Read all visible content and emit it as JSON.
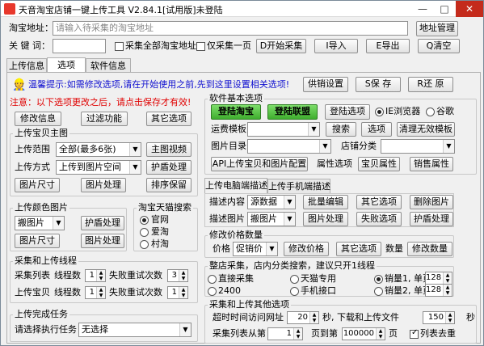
{
  "window": {
    "title": "天音淘宝店铺一键上传工具 V2.84.1[试用版]未登陆"
  },
  "top": {
    "url_label": "淘宝地址：",
    "url_placeholder": "请输入待采集的淘宝地址",
    "url_manage": "地址管理",
    "keyword_label": "关 键 词：",
    "keyword_value": "",
    "chk_all_shop": "采集全部淘宝地址",
    "chk_one_page": "仅采集一页",
    "btn_start": "D开始采集",
    "btn_import": "I导入",
    "btn_export": "E导出",
    "btn_clear": "Q清空"
  },
  "tabs": [
    {
      "label": "上传信息",
      "active": false
    },
    {
      "label": "选项",
      "active": true
    },
    {
      "label": "软件信息",
      "active": false
    }
  ],
  "tip": {
    "text": "温馨提示:如需修改选项,请在开始使用之前,先到这里设置相关选项!",
    "btn_supply": "供销设置",
    "btn_save": "S保 存",
    "btn_restore": "R还 原"
  },
  "left": {
    "warning": "注意：以下选项更改之后，请点击保存才有效!",
    "btn_modify": "修改信息",
    "btn_filter": "过滤功能",
    "btn_other": "其它选项",
    "main_pic": {
      "title": "上传宝贝主图",
      "range_label": "上传范围",
      "range_value": "全部(最多6张)",
      "btn_video": "主图视频",
      "method_label": "上传方式",
      "method_value": "上传到图片空间",
      "btn_shield": "护盾处理",
      "btn_size": "图片尺寸",
      "btn_process": "图片处理",
      "btn_sort": "排序保留"
    },
    "color_pic": {
      "title": "上传颜色图片",
      "value": "搬图片",
      "btn_shield": "护盾处理",
      "btn_size": "图片尺寸",
      "btn_process": "图片处理"
    },
    "tmall": {
      "title": "淘宝天猫搜索",
      "opt1": "官网",
      "opt2": "爱淘",
      "opt3": "村淘"
    },
    "threads": {
      "title": "采集和上传线程",
      "list_label": "采集列表",
      "item_label": "上传宝贝",
      "threads_label": "线程数",
      "retry_label": "失败重试次数",
      "list_threads": "1",
      "list_retry": "3",
      "item_threads": "1",
      "item_retry": "1"
    },
    "finish": {
      "title": "上传完成任务",
      "label": "请选择执行任务",
      "value": "无选择"
    }
  },
  "right": {
    "basic": {
      "title": "软件基本选项",
      "btn_login_tb": "登陆淘宝",
      "btn_login_union": "登陆联盟",
      "btn_login_opt": "登陆选项",
      "browser_ie": "IE浏览器",
      "browser_chrome": "谷歌",
      "shipping_label": "运费模板",
      "btn_search": "搜索",
      "btn_options": "选项",
      "btn_clean_tpl": "清理无效模板",
      "dir_label": "图片目录",
      "shop_cat_label": "店铺分类",
      "btn_api": "API上传宝贝和图片配置",
      "attr_label": "属性选项",
      "btn_attr": "宝贝属性",
      "btn_sales_attr": "销售属性"
    },
    "desc_tabs": [
      "上传电脑端描述",
      "上传手机端描述"
    ],
    "desc": {
      "content_label": "描述内容",
      "content_value": "源数据",
      "btn_batch": "批量编辑",
      "btn_other": "其它选项",
      "btn_delete_pic": "删除图片",
      "pic_label": "描述图片",
      "pic_value": "搬图片",
      "btn_process": "图片处理",
      "btn_fail": "失败选项",
      "btn_shield": "护盾处理"
    },
    "price": {
      "title": "修改价格数量",
      "label": "价格",
      "value": "促销价",
      "btn_modify": "修改价格",
      "btn_other": "其它选项",
      "qty_label": "数量",
      "btn_qty": "修改数量"
    },
    "shop": {
      "title": "整店采集，店内分类搜索，建议只开1线程",
      "opt1": "直接采集",
      "opt2": "天猫专用",
      "opt3": "2400",
      "opt4": "手机接口",
      "opt5": "销量1, 单页",
      "opt6": "销量2, 单页",
      "val1": "128",
      "val2": "128"
    },
    "other": {
      "title": "采集和上传其他选项",
      "timeout_label": "超时时间",
      "visit_label": "访问网址",
      "visit_value": "20",
      "sec_label": "秒, 下载和上传文件",
      "dl_value": "150",
      "sec2_label": "秒",
      "list_label": "采集列表",
      "from_label": "从第",
      "from_value": "1",
      "to_label": "页到第",
      "to_value": "100000",
      "page_label": "页",
      "chk_dedup": "列表去重"
    }
  }
}
